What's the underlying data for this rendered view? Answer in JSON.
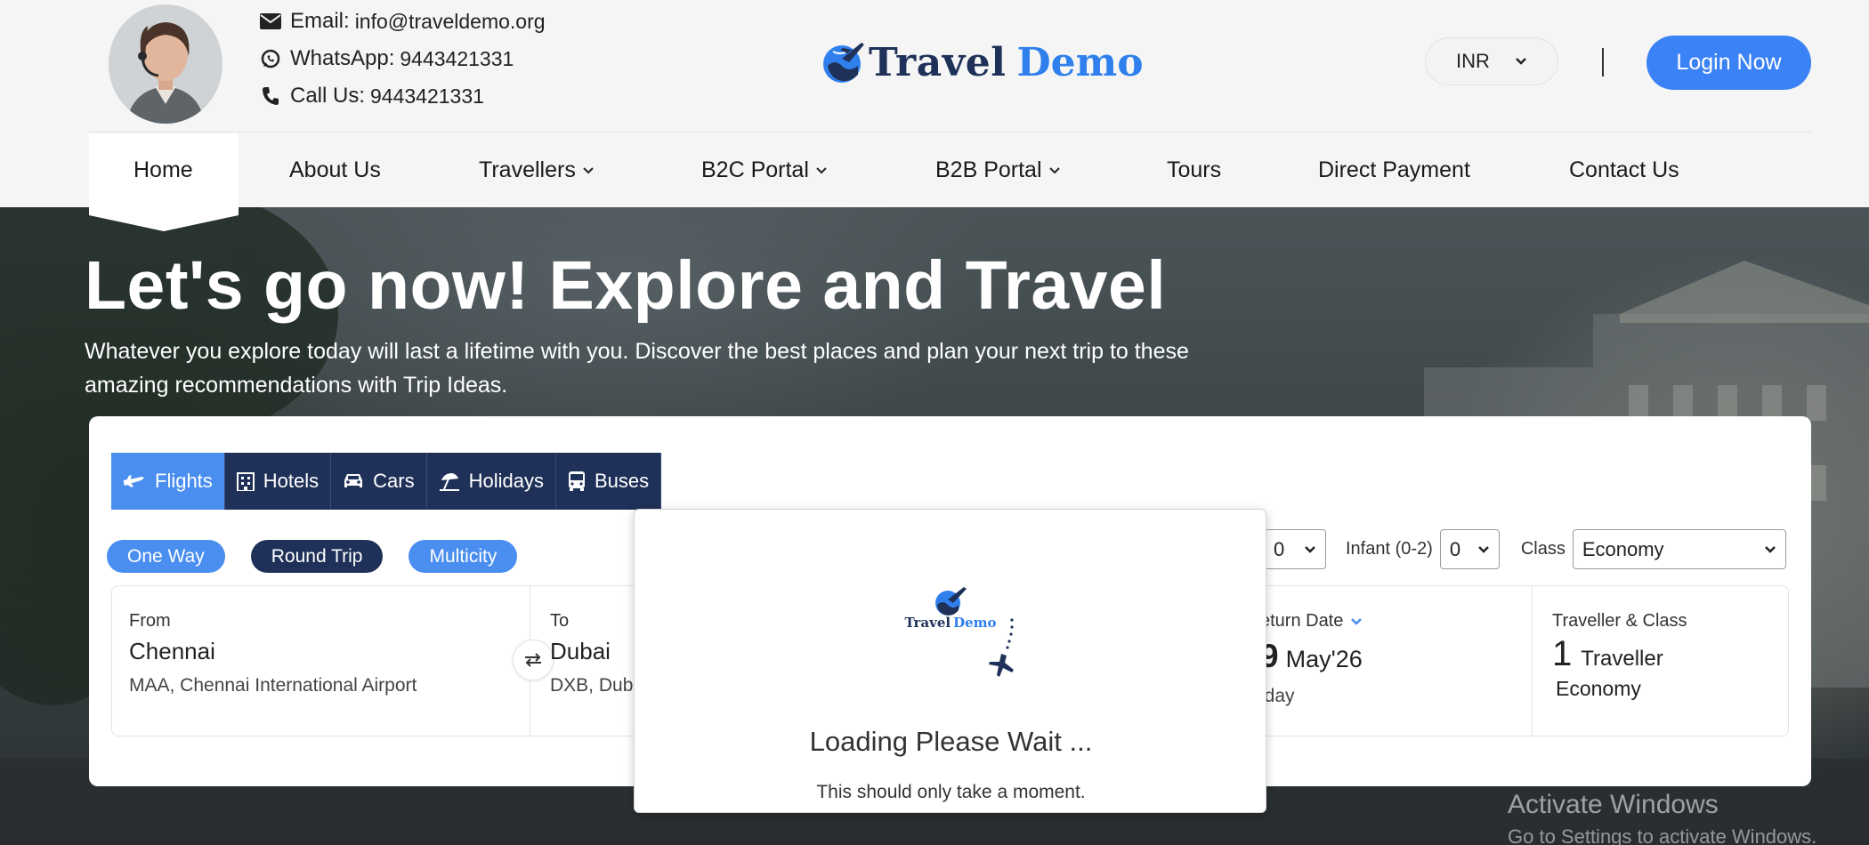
{
  "header": {
    "contact": {
      "email_label": "Email:",
      "email_value": "info@traveldemo.org",
      "whatsapp_label": "WhatsApp:",
      "whatsapp_value": "9443421331",
      "call_label": "Call Us:",
      "call_value": "9443421331"
    },
    "logo": {
      "word1": "Travel",
      "word2": "Demo"
    },
    "currency": "INR",
    "login_label": "Login Now"
  },
  "nav": {
    "items": [
      {
        "label": "Home",
        "active": true
      },
      {
        "label": "About Us"
      },
      {
        "label": "Travellers",
        "dropdown": true
      },
      {
        "label": "B2C Portal",
        "dropdown": true
      },
      {
        "label": "B2B Portal",
        "dropdown": true
      },
      {
        "label": "Tours"
      },
      {
        "label": "Direct Payment"
      },
      {
        "label": "Contact Us"
      }
    ]
  },
  "hero": {
    "title": "Let's go now! Explore and Travel",
    "subtitle": "Whatever you explore today will last a lifetime with you. Discover the best places and plan your next trip to these amazing recommendations with Trip Ideas."
  },
  "search": {
    "tabs": [
      "Flights",
      "Hotels",
      "Cars",
      "Holidays",
      "Buses"
    ],
    "active_tab": "Flights",
    "trip_types": [
      "One Way",
      "Round Trip",
      "Multicity"
    ],
    "active_trip": "Round Trip",
    "pax": {
      "child_value": "0",
      "infant_label": "Infant (0-2)",
      "infant_value": "0",
      "class_label": "Class",
      "class_value": "Economy"
    },
    "from": {
      "label": "From",
      "city": "Chennai",
      "airport": "MAA, Chennai International Airport"
    },
    "to": {
      "label": "To",
      "city": "Dubai",
      "airport": "DXB, Dub"
    },
    "return": {
      "label": "eturn Date",
      "day": "9",
      "month": "May'26",
      "weekday": "iday"
    },
    "traveller": {
      "label": "Traveller & Class",
      "count": "1",
      "unit": "Traveller",
      "class": "Economy"
    }
  },
  "modal": {
    "logo_word1": "Travel",
    "logo_word2": "Demo",
    "title": "Loading Please Wait ...",
    "subtitle": "This should only take a moment."
  },
  "watermark": {
    "line1": "Activate Windows",
    "line2": "Go to Settings to activate Windows."
  },
  "colors": {
    "brand_navy": "#1f3158",
    "brand_blue": "#3b82f6",
    "tab_active": "#4a8ef0"
  }
}
